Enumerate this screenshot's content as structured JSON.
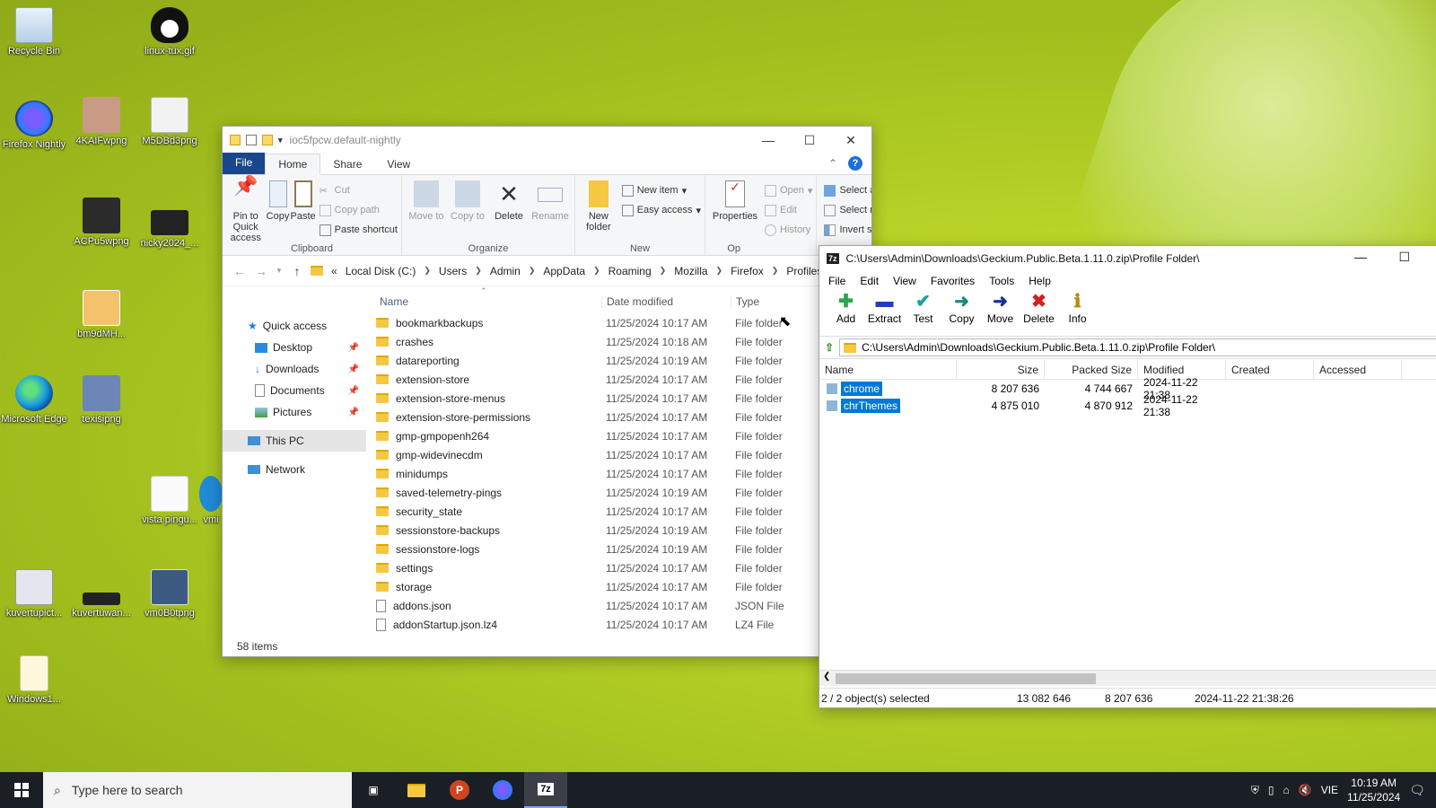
{
  "desktop": {
    "icons": [
      {
        "label": "Recycle Bin"
      },
      {
        "label": "linux-tux.gif"
      },
      {
        "label": "Firefox Nightly"
      },
      {
        "label": "4KAIFwpng"
      },
      {
        "label": "M5DBd3png"
      },
      {
        "label": "ACPu5wpng"
      },
      {
        "label": "nicky2024_..."
      },
      {
        "label": "bm9dMH..."
      },
      {
        "label": "Microsoft Edge"
      },
      {
        "label": "texisipng"
      },
      {
        "label": "vista pingu..."
      },
      {
        "label": "vmi"
      },
      {
        "label": "kuvertupict..."
      },
      {
        "label": "kuvertuwan..."
      },
      {
        "label": "vm0B0tpng"
      },
      {
        "label": "Windows1..."
      }
    ]
  },
  "explorer": {
    "title": "ioc5fpcw.default-nightly",
    "tabs": {
      "file": "File",
      "home": "Home",
      "share": "Share",
      "view": "View"
    },
    "ribbon": {
      "clipboard": {
        "name": "Clipboard",
        "pin": "Pin to Quick access",
        "copy": "Copy",
        "paste": "Paste",
        "cut": "Cut",
        "copy_path": "Copy path",
        "paste_shortcut": "Paste shortcut"
      },
      "organize": {
        "name": "Organize",
        "move_to": "Move to",
        "copy_to": "Copy to",
        "delete": "Delete",
        "rename": "Rename"
      },
      "new": {
        "name": "New",
        "new_folder": "New folder",
        "new_item": "New item",
        "easy_access": "Easy access"
      },
      "open": {
        "name": "Op",
        "properties": "Properties",
        "open": "Open",
        "edit": "Edit",
        "history": "History"
      },
      "select": {
        "select_all": "Select all",
        "select_none": "Select none",
        "invert": "Invert selection"
      }
    },
    "address": {
      "prefix": "«",
      "crumbs": [
        "Local Disk (C:)",
        "Users",
        "Admin",
        "AppData",
        "Roaming",
        "Mozilla",
        "Firefox",
        "Profiles"
      ]
    },
    "nav": {
      "quick_access": "Quick access",
      "items": [
        "Desktop",
        "Downloads",
        "Documents",
        "Pictures"
      ],
      "this_pc": "This PC",
      "network": "Network"
    },
    "columns": {
      "name": "Name",
      "date": "Date modified",
      "type": "Type"
    },
    "files": [
      {
        "name": "bookmarkbackups",
        "date": "11/25/2024 10:17 AM",
        "type": "File folder",
        "kind": "folder"
      },
      {
        "name": "crashes",
        "date": "11/25/2024 10:18 AM",
        "type": "File folder",
        "kind": "folder"
      },
      {
        "name": "datareporting",
        "date": "11/25/2024 10:19 AM",
        "type": "File folder",
        "kind": "folder"
      },
      {
        "name": "extension-store",
        "date": "11/25/2024 10:17 AM",
        "type": "File folder",
        "kind": "folder"
      },
      {
        "name": "extension-store-menus",
        "date": "11/25/2024 10:17 AM",
        "type": "File folder",
        "kind": "folder"
      },
      {
        "name": "extension-store-permissions",
        "date": "11/25/2024 10:17 AM",
        "type": "File folder",
        "kind": "folder"
      },
      {
        "name": "gmp-gmpopenh264",
        "date": "11/25/2024 10:17 AM",
        "type": "File folder",
        "kind": "folder"
      },
      {
        "name": "gmp-widevinecdm",
        "date": "11/25/2024 10:17 AM",
        "type": "File folder",
        "kind": "folder"
      },
      {
        "name": "minidumps",
        "date": "11/25/2024 10:17 AM",
        "type": "File folder",
        "kind": "folder"
      },
      {
        "name": "saved-telemetry-pings",
        "date": "11/25/2024 10:19 AM",
        "type": "File folder",
        "kind": "folder"
      },
      {
        "name": "security_state",
        "date": "11/25/2024 10:17 AM",
        "type": "File folder",
        "kind": "folder"
      },
      {
        "name": "sessionstore-backups",
        "date": "11/25/2024 10:19 AM",
        "type": "File folder",
        "kind": "folder"
      },
      {
        "name": "sessionstore-logs",
        "date": "11/25/2024 10:19 AM",
        "type": "File folder",
        "kind": "folder"
      },
      {
        "name": "settings",
        "date": "11/25/2024 10:17 AM",
        "type": "File folder",
        "kind": "folder"
      },
      {
        "name": "storage",
        "date": "11/25/2024 10:17 AM",
        "type": "File folder",
        "kind": "folder"
      },
      {
        "name": "addons.json",
        "date": "11/25/2024 10:17 AM",
        "type": "JSON File",
        "kind": "file"
      },
      {
        "name": "addonStartup.json.lz4",
        "date": "11/25/2024 10:17 AM",
        "type": "LZ4 File",
        "kind": "file"
      }
    ],
    "status": "58 items"
  },
  "sevenzip": {
    "title": "C:\\Users\\Admin\\Downloads\\Geckium.Public.Beta.1.11.0.zip\\Profile Folder\\",
    "menu": [
      "File",
      "Edit",
      "View",
      "Favorites",
      "Tools",
      "Help"
    ],
    "toolbar": [
      {
        "label": "Add",
        "icon": "add-icon",
        "glyph": "✚",
        "color": "#2ea44f"
      },
      {
        "label": "Extract",
        "icon": "extract-icon",
        "glyph": "▬",
        "color": "#1f3fbf"
      },
      {
        "label": "Test",
        "icon": "test-icon",
        "glyph": "✔",
        "color": "#1aa0a0"
      },
      {
        "label": "Copy",
        "icon": "copy-icon",
        "glyph": "➜",
        "color": "#1a8a80"
      },
      {
        "label": "Move",
        "icon": "move-icon",
        "glyph": "➜",
        "color": "#1d2f9a"
      },
      {
        "label": "Delete",
        "icon": "delete-icon",
        "glyph": "✖",
        "color": "#d21f1f"
      },
      {
        "label": "Info",
        "icon": "info-icon",
        "glyph": "ℹ",
        "color": "#b8860b"
      }
    ],
    "path": "C:\\Users\\Admin\\Downloads\\Geckium.Public.Beta.1.11.0.zip\\Profile Folder\\",
    "columns": {
      "name": "Name",
      "size": "Size",
      "packed": "Packed Size",
      "modified": "Modified",
      "created": "Created",
      "accessed": "Accessed"
    },
    "rows": [
      {
        "name": "chrome",
        "size": "8 207 636",
        "packed": "4 744 667",
        "modified": "2024-11-22 21:38"
      },
      {
        "name": "chrThemes",
        "size": "4 875 010",
        "packed": "4 870 912",
        "modified": "2024-11-22 21:38"
      }
    ],
    "status": {
      "selected": "2 / 2 object(s) selected",
      "total": "13 082 646",
      "packed": "8 207 636",
      "date": "2024-11-22 21:38:26"
    }
  },
  "taskbar": {
    "search_placeholder": "Type here to search",
    "lang": "VIE",
    "time": "10:19 AM",
    "date": "11/25/2024"
  }
}
